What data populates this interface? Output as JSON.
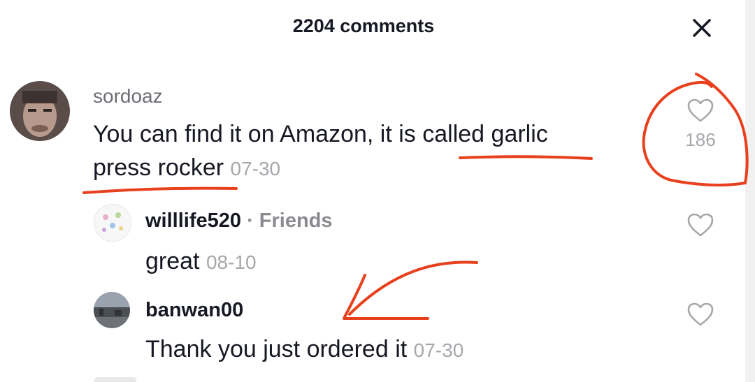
{
  "header": {
    "title": "2204 comments",
    "close_icon": "close-icon"
  },
  "comments": [
    {
      "username": "sordoaz",
      "text_line1": "You can find it on Amazon, it is called garlic",
      "text_line2": "press rocker",
      "date": "07-30",
      "likes": "186",
      "avatar_icon": "user-avatar"
    }
  ],
  "replies": [
    {
      "username": "willlife520",
      "separator": " · ",
      "tag": "Friends",
      "text": "great",
      "date": "08-10",
      "avatar_icon": "user-avatar"
    },
    {
      "username": "banwan00",
      "text": "Thank you just ordered it",
      "date": "07-30",
      "avatar_icon": "user-avatar"
    }
  ],
  "icons": {
    "like": "heart-outline-icon",
    "close": "close-icon"
  },
  "colors": {
    "annotation": "#e8401c",
    "secondary_text": "#a6a7ab",
    "primary_text": "#161823"
  }
}
